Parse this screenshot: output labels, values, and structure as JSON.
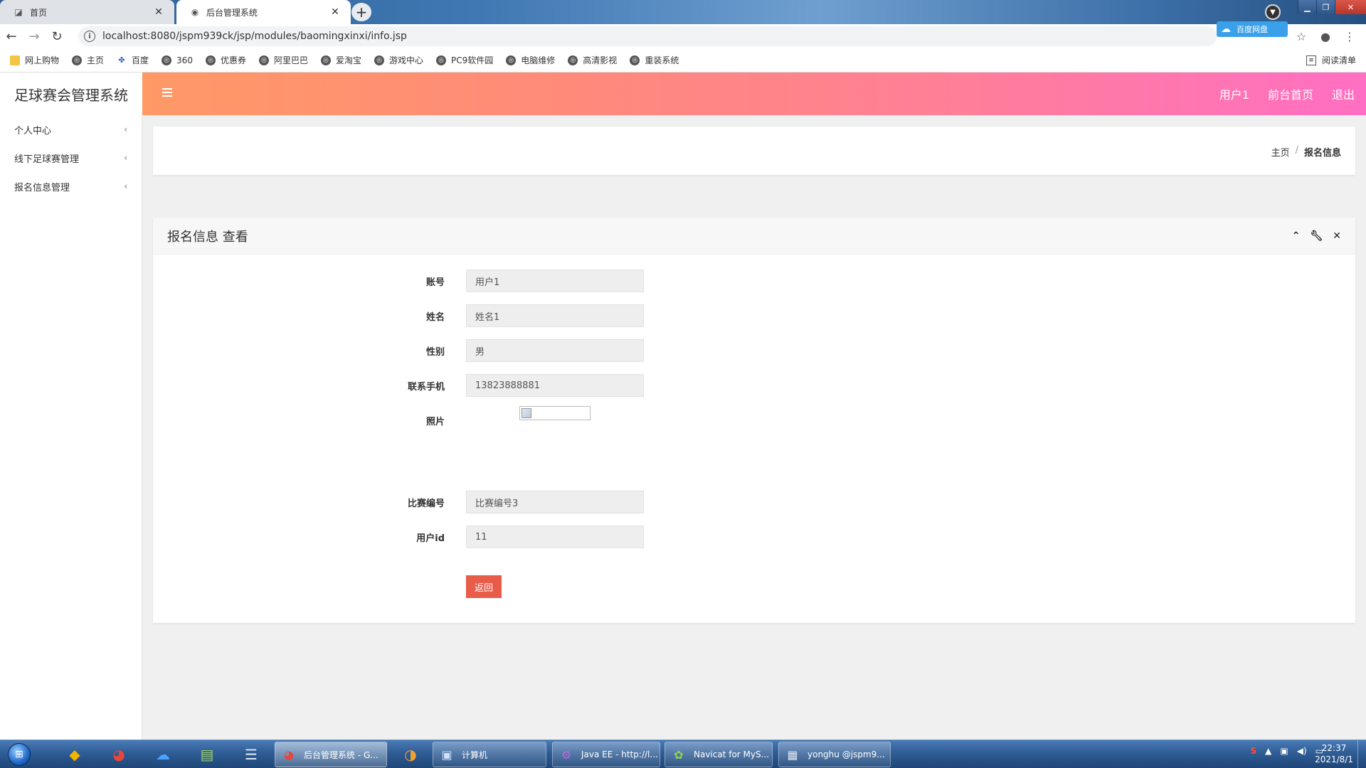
{
  "browser": {
    "tabs": [
      {
        "title": "首页",
        "active": false
      },
      {
        "title": "后台管理系统",
        "active": true
      }
    ],
    "url": "localhost:8080/jspm939ck/jsp/modules/baomingxinxi/info.jsp",
    "baidu_label": "百度网盘",
    "bookmarks": [
      "网上购物",
      "主页",
      "百度",
      "360",
      "优惠券",
      "阿里巴巴",
      "爱淘宝",
      "游戏中心",
      "PC9软件园",
      "电脑维修",
      "高清影视",
      "重装系统"
    ],
    "reading_list": "阅读清单"
  },
  "app": {
    "brand": "足球赛会管理系统",
    "top_links": [
      "用户1",
      "前台首页",
      "退出"
    ],
    "sidebar": [
      {
        "label": "个人中心"
      },
      {
        "label": "线下足球赛管理"
      },
      {
        "label": "报名信息管理"
      }
    ],
    "breadcrumb": {
      "home": "主页",
      "separator": "/",
      "current": "报名信息"
    },
    "panel": {
      "title": "报名信息 查看",
      "fields": [
        {
          "label": "账号",
          "value": "用户1"
        },
        {
          "label": "姓名",
          "value": "姓名1"
        },
        {
          "label": "性别",
          "value": "男"
        },
        {
          "label": "联系手机",
          "value": "13823888881"
        },
        {
          "label": "照片",
          "value": ""
        },
        {
          "label": "比赛编号",
          "value": "比赛编号3"
        },
        {
          "label": "用户id",
          "value": "11"
        }
      ],
      "back_label": "返回"
    }
  },
  "taskbar": {
    "tasks": [
      {
        "label": "后台管理系统 - G..."
      },
      {
        "label": "计算机"
      },
      {
        "label": "Java EE - http://l..."
      },
      {
        "label": "Navicat for MyS..."
      },
      {
        "label": "yonghu @jspm9..."
      }
    ],
    "time": "22:37",
    "date": "2021/8/1"
  },
  "colors": {
    "header_gradient_start": "#ff9966",
    "header_gradient_end": "#ff6fc3",
    "back_button": "#e85c4a"
  }
}
